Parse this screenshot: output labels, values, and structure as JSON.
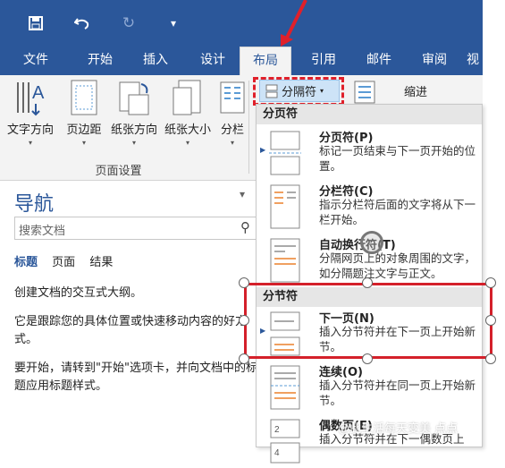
{
  "quick_access": {
    "customize_caret": "▾"
  },
  "tabs": [
    {
      "label": "文件"
    },
    {
      "label": "开始"
    },
    {
      "label": "插入"
    },
    {
      "label": "设计"
    },
    {
      "label": "布局"
    },
    {
      "label": "引用"
    },
    {
      "label": "邮件"
    },
    {
      "label": "审阅"
    },
    {
      "label": "视"
    }
  ],
  "ribbon": {
    "buttons": [
      {
        "label": "文字方向"
      },
      {
        "label": "页边距"
      },
      {
        "label": "纸张方向"
      },
      {
        "label": "纸张大小"
      },
      {
        "label": "分栏"
      }
    ],
    "group_label": "页面设置",
    "breaks_label": "分隔符",
    "indent_label": "缩进"
  },
  "nav_pane": {
    "title": "导航",
    "search_placeholder": "搜索文档",
    "tabs": [
      "标题",
      "页面",
      "结果"
    ],
    "paragraphs": [
      "创建文档的交互式大纲。",
      "它是跟踪您的具体位置或快速移动内容的好方式。",
      "要开始，请转到\"开始\"选项卡，并向文档中的标题应用标题样式。"
    ]
  },
  "breaks_menu": {
    "page_breaks_header": "分页符",
    "section_breaks_header": "分节符",
    "items": [
      {
        "title": "分页符(P)",
        "desc": "标记一页结束与下一页开始的位置。"
      },
      {
        "title": "分栏符(C)",
        "desc": "指示分栏符后面的文字将从下一栏开始。"
      },
      {
        "title": "自动换行符(T)",
        "desc": "分隔网页上的对象周围的文字，如分隔题注文字与正文。"
      },
      {
        "title": "下一页(N)",
        "desc": "插入分节符并在下一页上开始新节。"
      },
      {
        "title": "连续(O)",
        "desc": "插入分节符并在同一页上开始新节。"
      },
      {
        "title": "偶数页(E)",
        "desc": "插入分节符并在下一偶数页上"
      }
    ]
  },
  "watermark": "@此生活每天变美 点点",
  "colors": {
    "ribbon_blue": "#2b579a",
    "highlight_red": "#e0202a",
    "ribbon_bg": "#f3f3f3"
  }
}
